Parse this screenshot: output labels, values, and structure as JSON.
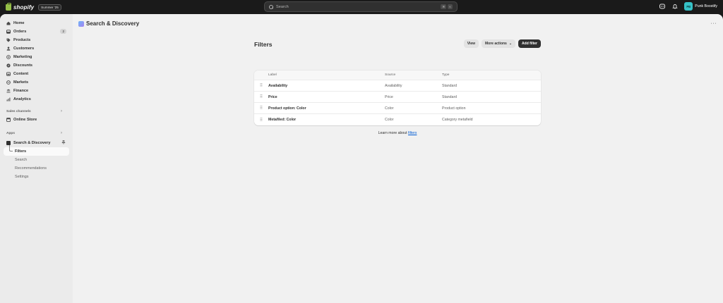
{
  "topbar": {
    "brand": "shopify",
    "edition": "Summer '25",
    "search_placeholder": "Search",
    "shortcut": [
      "⌘",
      "K"
    ],
    "avatar_initials": "PB",
    "store_name": "Punk Boostify"
  },
  "sidebar": {
    "items": [
      {
        "label": "Home",
        "icon": "home-icon"
      },
      {
        "label": "Orders",
        "icon": "orders-icon",
        "badge": "2"
      },
      {
        "label": "Products",
        "icon": "tag-icon"
      },
      {
        "label": "Customers",
        "icon": "person-icon"
      },
      {
        "label": "Marketing",
        "icon": "target-icon"
      },
      {
        "label": "Discounts",
        "icon": "discount-icon"
      },
      {
        "label": "Content",
        "icon": "content-icon"
      },
      {
        "label": "Markets",
        "icon": "globe-icon"
      },
      {
        "label": "Finance",
        "icon": "bank-icon"
      },
      {
        "label": "Analytics",
        "icon": "chart-icon"
      }
    ],
    "sales_channels_label": "Sales channels",
    "online_store_label": "Online Store",
    "apps_label": "Apps",
    "app_name": "Search & Discovery",
    "app_subitems": [
      "Filters",
      "Search",
      "Recommendations",
      "Settings"
    ],
    "active_subitem": "Filters"
  },
  "main": {
    "app_title": "Search & Discovery",
    "page_title": "Filters",
    "buttons": {
      "view": "View",
      "more_actions": "More actions",
      "add_filter": "Add filter"
    },
    "table": {
      "headers": {
        "label": "Label",
        "source": "Source",
        "type": "Type"
      },
      "rows": [
        {
          "label": "Availability",
          "source": "Availability",
          "type": "Standard"
        },
        {
          "label": "Price",
          "source": "Price",
          "type": "Standard"
        },
        {
          "label": "Product option: Color",
          "source": "Color",
          "type": "Product option"
        },
        {
          "label": "Metafiled: Color",
          "source": "Color",
          "type": "Category metafield"
        }
      ]
    },
    "learn_more_text": "Learn more about ",
    "learn_more_link": "filters"
  }
}
